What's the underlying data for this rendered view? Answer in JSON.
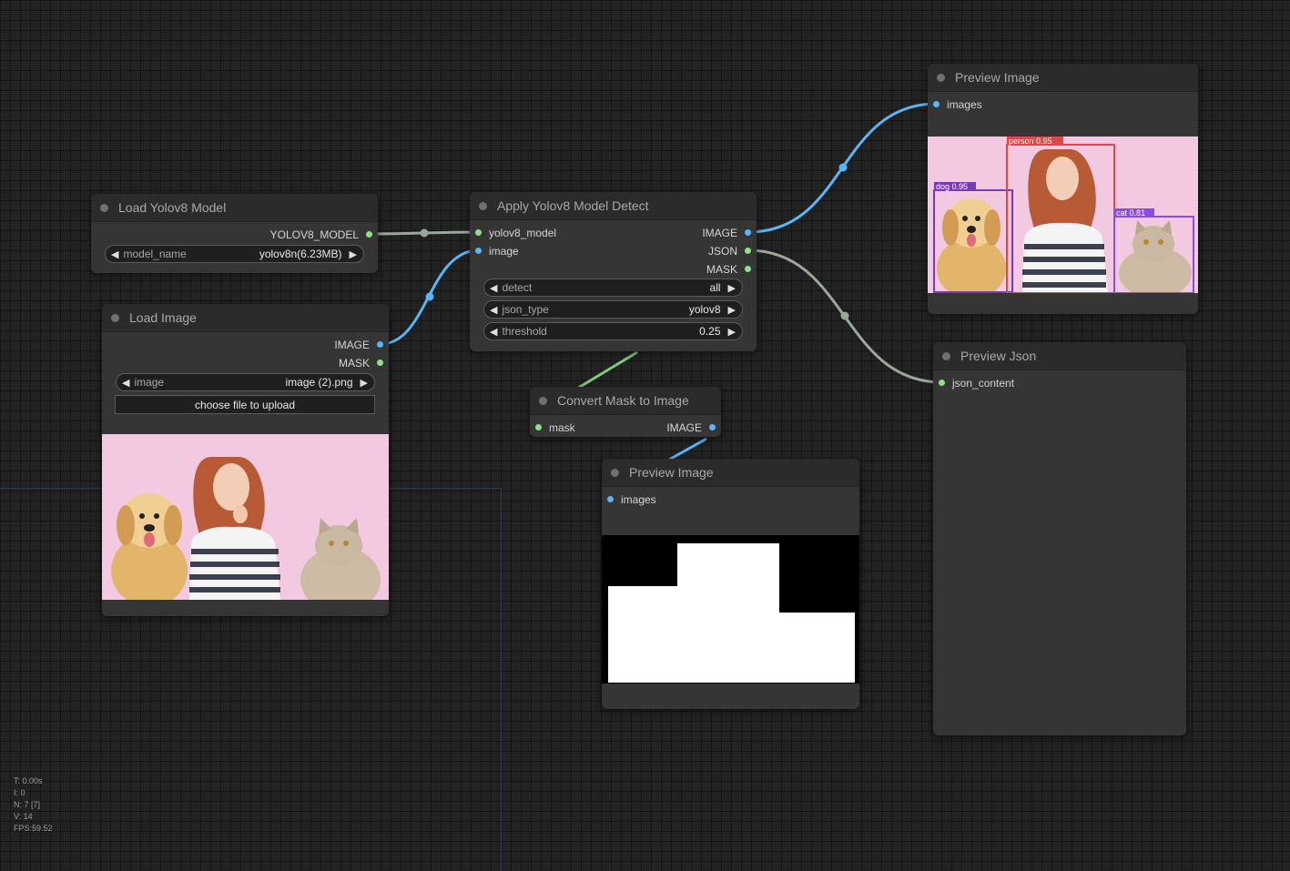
{
  "nodes": {
    "load_yolo": {
      "title": "Load Yolov8 Model",
      "output": "YOLOV8_MODEL",
      "widget_label": "model_name",
      "widget_value": "yolov8n(6.23MB)"
    },
    "load_image": {
      "title": "Load Image",
      "outputs": [
        "IMAGE",
        "MASK"
      ],
      "widget_label": "image",
      "widget_value": "image (2).png",
      "upload_label": "choose file to upload"
    },
    "apply_detect": {
      "title": "Apply Yolov8 Model Detect",
      "inputs": [
        "yolov8_model",
        "image"
      ],
      "outputs": [
        "IMAGE",
        "JSON",
        "MASK"
      ],
      "widgets": [
        {
          "label": "detect",
          "value": "all"
        },
        {
          "label": "json_type",
          "value": "yolov8"
        },
        {
          "label": "threshold",
          "value": "0.25"
        }
      ]
    },
    "convert_mask": {
      "title": "Convert Mask to Image",
      "input": "mask",
      "output": "IMAGE"
    },
    "preview_image_top": {
      "title": "Preview Image",
      "input": "images",
      "detections": [
        {
          "label": "dog 0.95"
        },
        {
          "label": "person 0.95"
        },
        {
          "label": "cat 0.81"
        }
      ]
    },
    "preview_image_mask": {
      "title": "Preview Image",
      "input": "images"
    },
    "preview_json": {
      "title": "Preview Json",
      "input": "json_content"
    }
  },
  "stats": {
    "time": "T: 0.00s",
    "iterations": "I: 0",
    "nodes": "N: 7 [7]",
    "vertices": "V: 14",
    "fps": "FPS:59.52"
  },
  "colors": {
    "canvas": "#222222",
    "node_body": "#353535",
    "node_title": "#2b2b2b",
    "image_port": "#5ab4f6",
    "other_port": "#8ee08a",
    "model_link": "#9aa89a",
    "json_link": "#9aa89a",
    "mask_link": "#7ec87a",
    "image_link": "#5ab4f6",
    "person_box": "#e04848",
    "dog_box": "#7a3ab8",
    "cat_box": "#8a4de0"
  }
}
